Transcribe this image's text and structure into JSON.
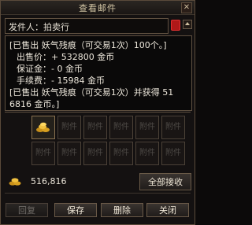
{
  "window": {
    "title": "查看邮件",
    "close_symbol": "✕"
  },
  "sender": {
    "text": "发件人：拍卖行"
  },
  "body": {
    "lines": [
      "[已售出 妖气残痕（可交易1次）100个。]",
      "出售价：+ 532800 金币",
      "保证金：- 0 金币",
      "手续费：- 15984 金币",
      "[已售出 妖气残痕（可交易1次）并获得 51",
      "6816 金币。]"
    ]
  },
  "attachments": {
    "slot_label": "附件",
    "rows": [
      [
        "",
        "附件",
        "附件",
        "附件",
        "附件",
        "附件"
      ],
      [
        "附件",
        "附件",
        "附件",
        "附件",
        "附件",
        "附件"
      ]
    ]
  },
  "money": {
    "amount": "516,816"
  },
  "buttons": {
    "receive_all": "全部接收",
    "reply": "回复",
    "save": "保存",
    "delete": "删除",
    "close": "关闭"
  },
  "colors": {
    "text": "#ece6da",
    "border": "#5f5040",
    "title": "#d4c7a6",
    "gold": "#e0b040",
    "seal": "#b01818"
  }
}
